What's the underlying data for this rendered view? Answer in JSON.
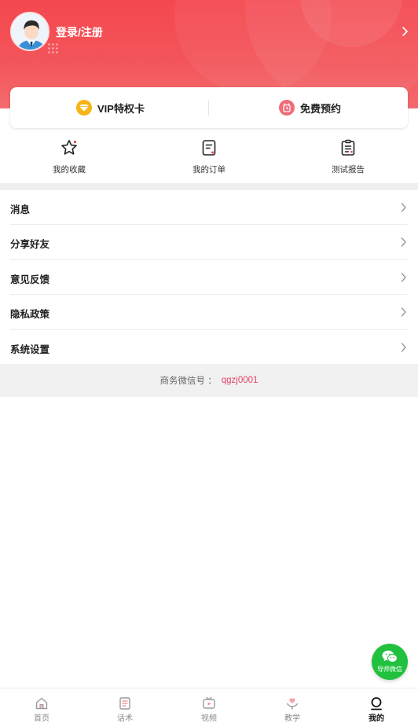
{
  "header": {
    "login_label": "登录/注册",
    "background_color": "#f4474f"
  },
  "cards": {
    "vip": {
      "label": "VIP特权卡",
      "icon": "diamond-icon",
      "color": "#f7b417"
    },
    "free": {
      "label": "免费预约",
      "icon": "alarm-clock-icon",
      "color": "#f06c78"
    }
  },
  "quick_actions": [
    {
      "label": "我的收藏",
      "icon": "star-icon"
    },
    {
      "label": "我的订单",
      "icon": "order-icon"
    },
    {
      "label": "测试报告",
      "icon": "report-clipboard-icon"
    }
  ],
  "menu": [
    {
      "label": "消息"
    },
    {
      "label": "分享好友"
    },
    {
      "label": "意见反馈"
    },
    {
      "label": "隐私政策"
    },
    {
      "label": "系统设置"
    }
  ],
  "footer": {
    "business_wechat_label": "商务微信号 ：",
    "business_wechat_id": "qgzj0001",
    "accent_color": "#e8446a"
  },
  "floating_button": {
    "label": "导师微信",
    "icon": "wechat-icon",
    "color": "#21c13f"
  },
  "tabbar": [
    {
      "label": "首页",
      "icon": "home-icon",
      "active": false
    },
    {
      "label": "话术",
      "icon": "script-doc-icon",
      "active": false
    },
    {
      "label": "视频",
      "icon": "video-icon",
      "active": false
    },
    {
      "label": "教学",
      "icon": "teaching-heart-icon",
      "active": false
    },
    {
      "label": "我的",
      "icon": "profile-icon",
      "active": true
    }
  ]
}
